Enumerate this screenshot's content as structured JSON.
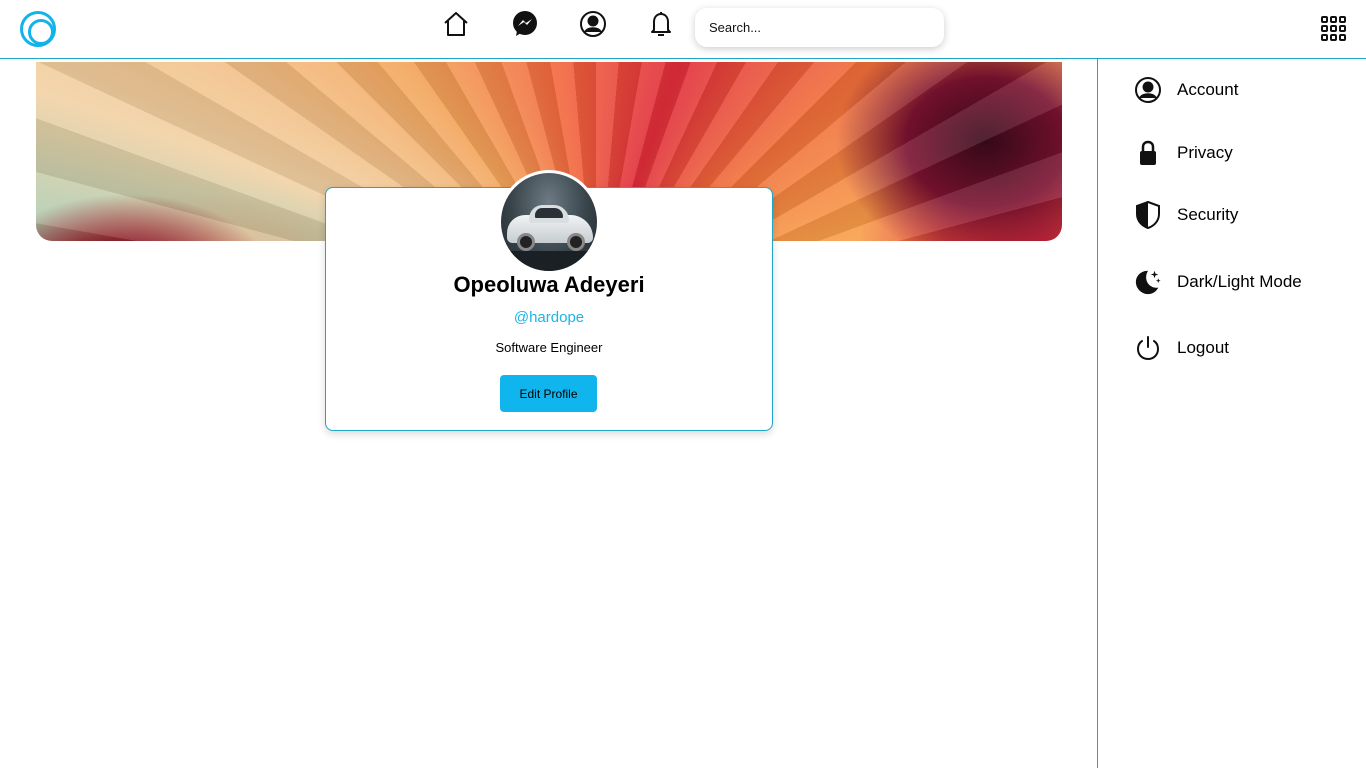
{
  "topbar": {
    "search_placeholder": "Search...",
    "icons": [
      "home-icon",
      "messenger-icon",
      "profile-icon",
      "bell-icon",
      "apps-grid-icon"
    ]
  },
  "profile": {
    "name": "Opeoluwa Adeyeri",
    "handle": "@hardope",
    "title": "Software Engineer",
    "edit_button": "Edit Profile"
  },
  "sidebar": {
    "items": [
      {
        "label": "Account",
        "icon": "account-icon"
      },
      {
        "label": "Privacy",
        "icon": "lock-icon"
      },
      {
        "label": "Security",
        "icon": "shield-icon"
      },
      {
        "label": "Dark/Light Mode",
        "icon": "moon-stars-icon"
      },
      {
        "label": "Logout",
        "icon": "power-icon"
      }
    ]
  },
  "colors": {
    "accent": "#10b5ee",
    "border": "#1fa6c9"
  }
}
